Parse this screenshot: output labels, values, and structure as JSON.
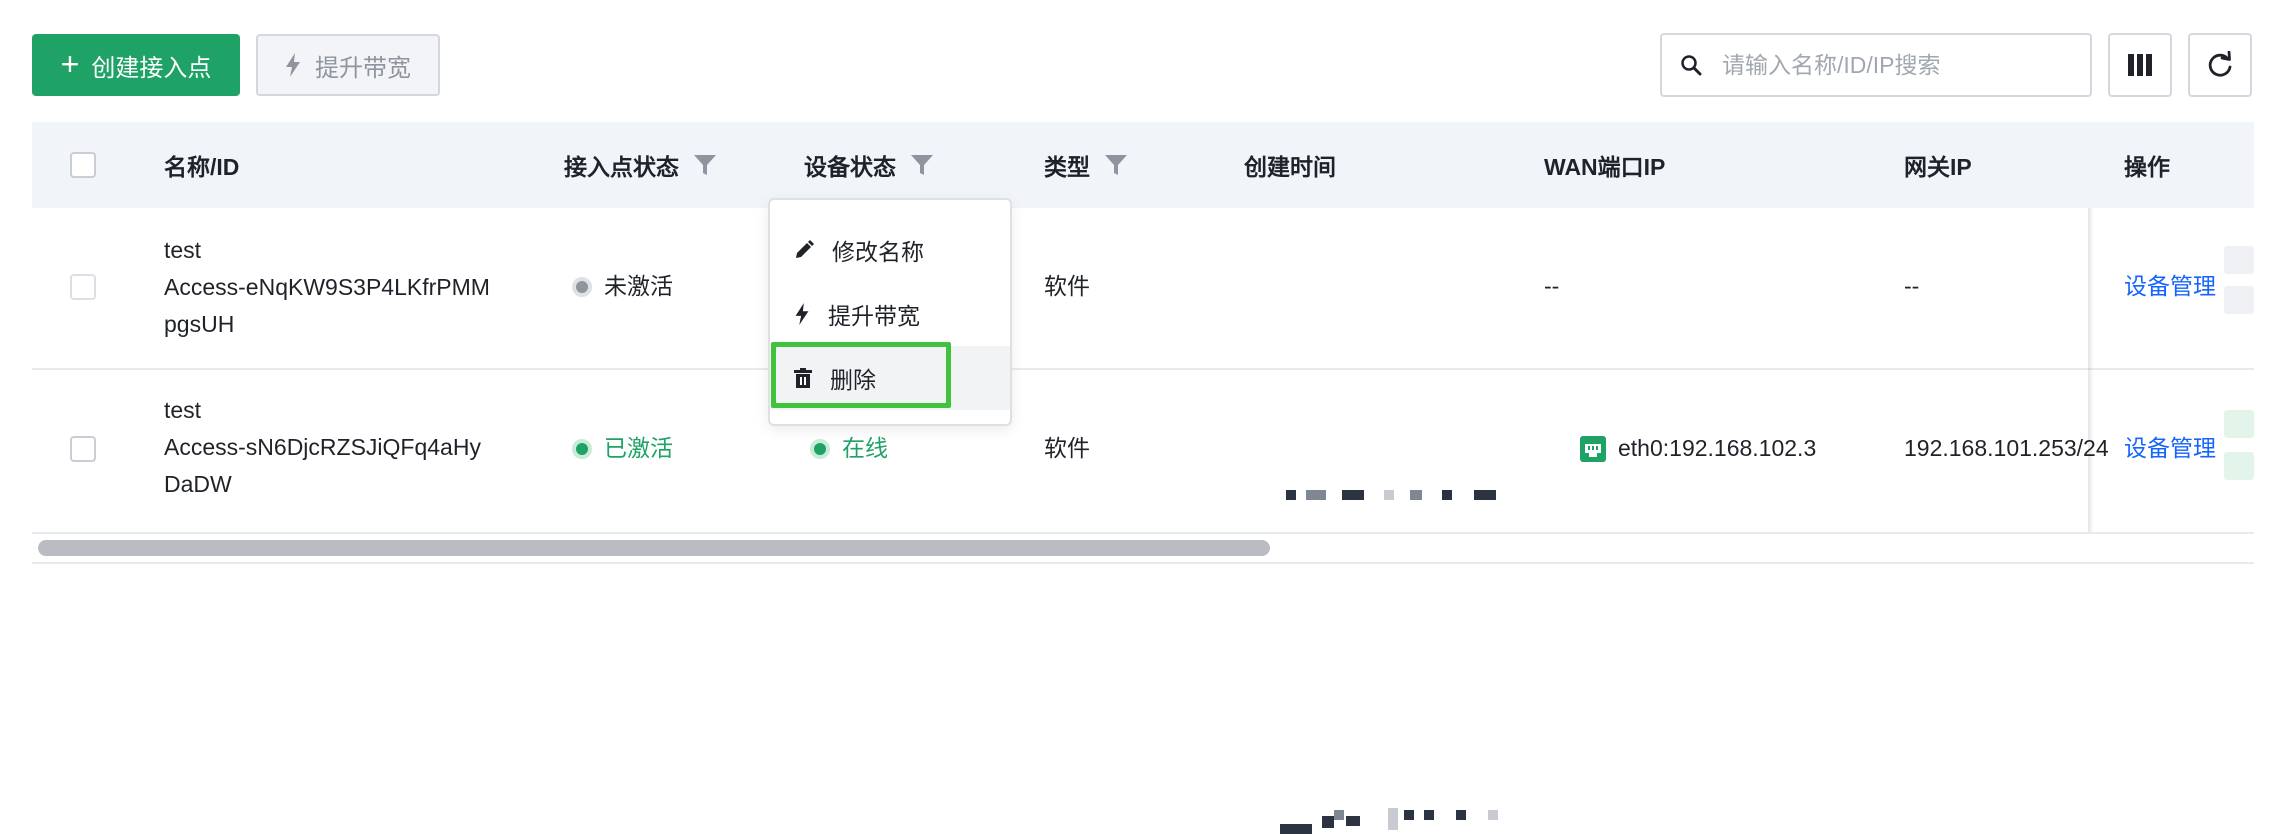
{
  "toolbar": {
    "create_label": "创建接入点",
    "upgrade_label": "提升带宽",
    "search_placeholder": "请输入名称/ID/IP搜索"
  },
  "table": {
    "headers": {
      "name": "名称/ID",
      "ap_status": "接入点状态",
      "device_status": "设备状态",
      "type": "类型",
      "created": "创建时间",
      "wan_ip": "WAN端口IP",
      "gateway_ip": "网关IP",
      "actions": "操作"
    },
    "rows": [
      {
        "name": "test",
        "id_line1": "Access-eNqKW9S3P4LKfrPMM",
        "id_line2": "pgsUH",
        "ap_status": "未激活",
        "device_status": "",
        "type": "软件",
        "wan_ip": "--",
        "gateway_ip": "--",
        "action": "设备管理"
      },
      {
        "name": "test",
        "id_line1": "Access-sN6DjcRZSJiQFq4aHy",
        "id_line2": "DaDW",
        "ap_status": "已激活",
        "device_status": "在线",
        "type": "软件",
        "wan_ip": "eth0:192.168.102.3",
        "gateway_ip": "192.168.101.253/24",
        "action": "设备管理"
      }
    ]
  },
  "menu": {
    "items": [
      {
        "label": "修改名称",
        "icon": "pencil-icon"
      },
      {
        "label": "提升带宽",
        "icon": "lightning-icon"
      },
      {
        "label": "删除",
        "icon": "trash-icon"
      }
    ]
  },
  "colors": {
    "primary": "#1ea265",
    "link": "#1664ff",
    "highlight": "#40c23c"
  }
}
